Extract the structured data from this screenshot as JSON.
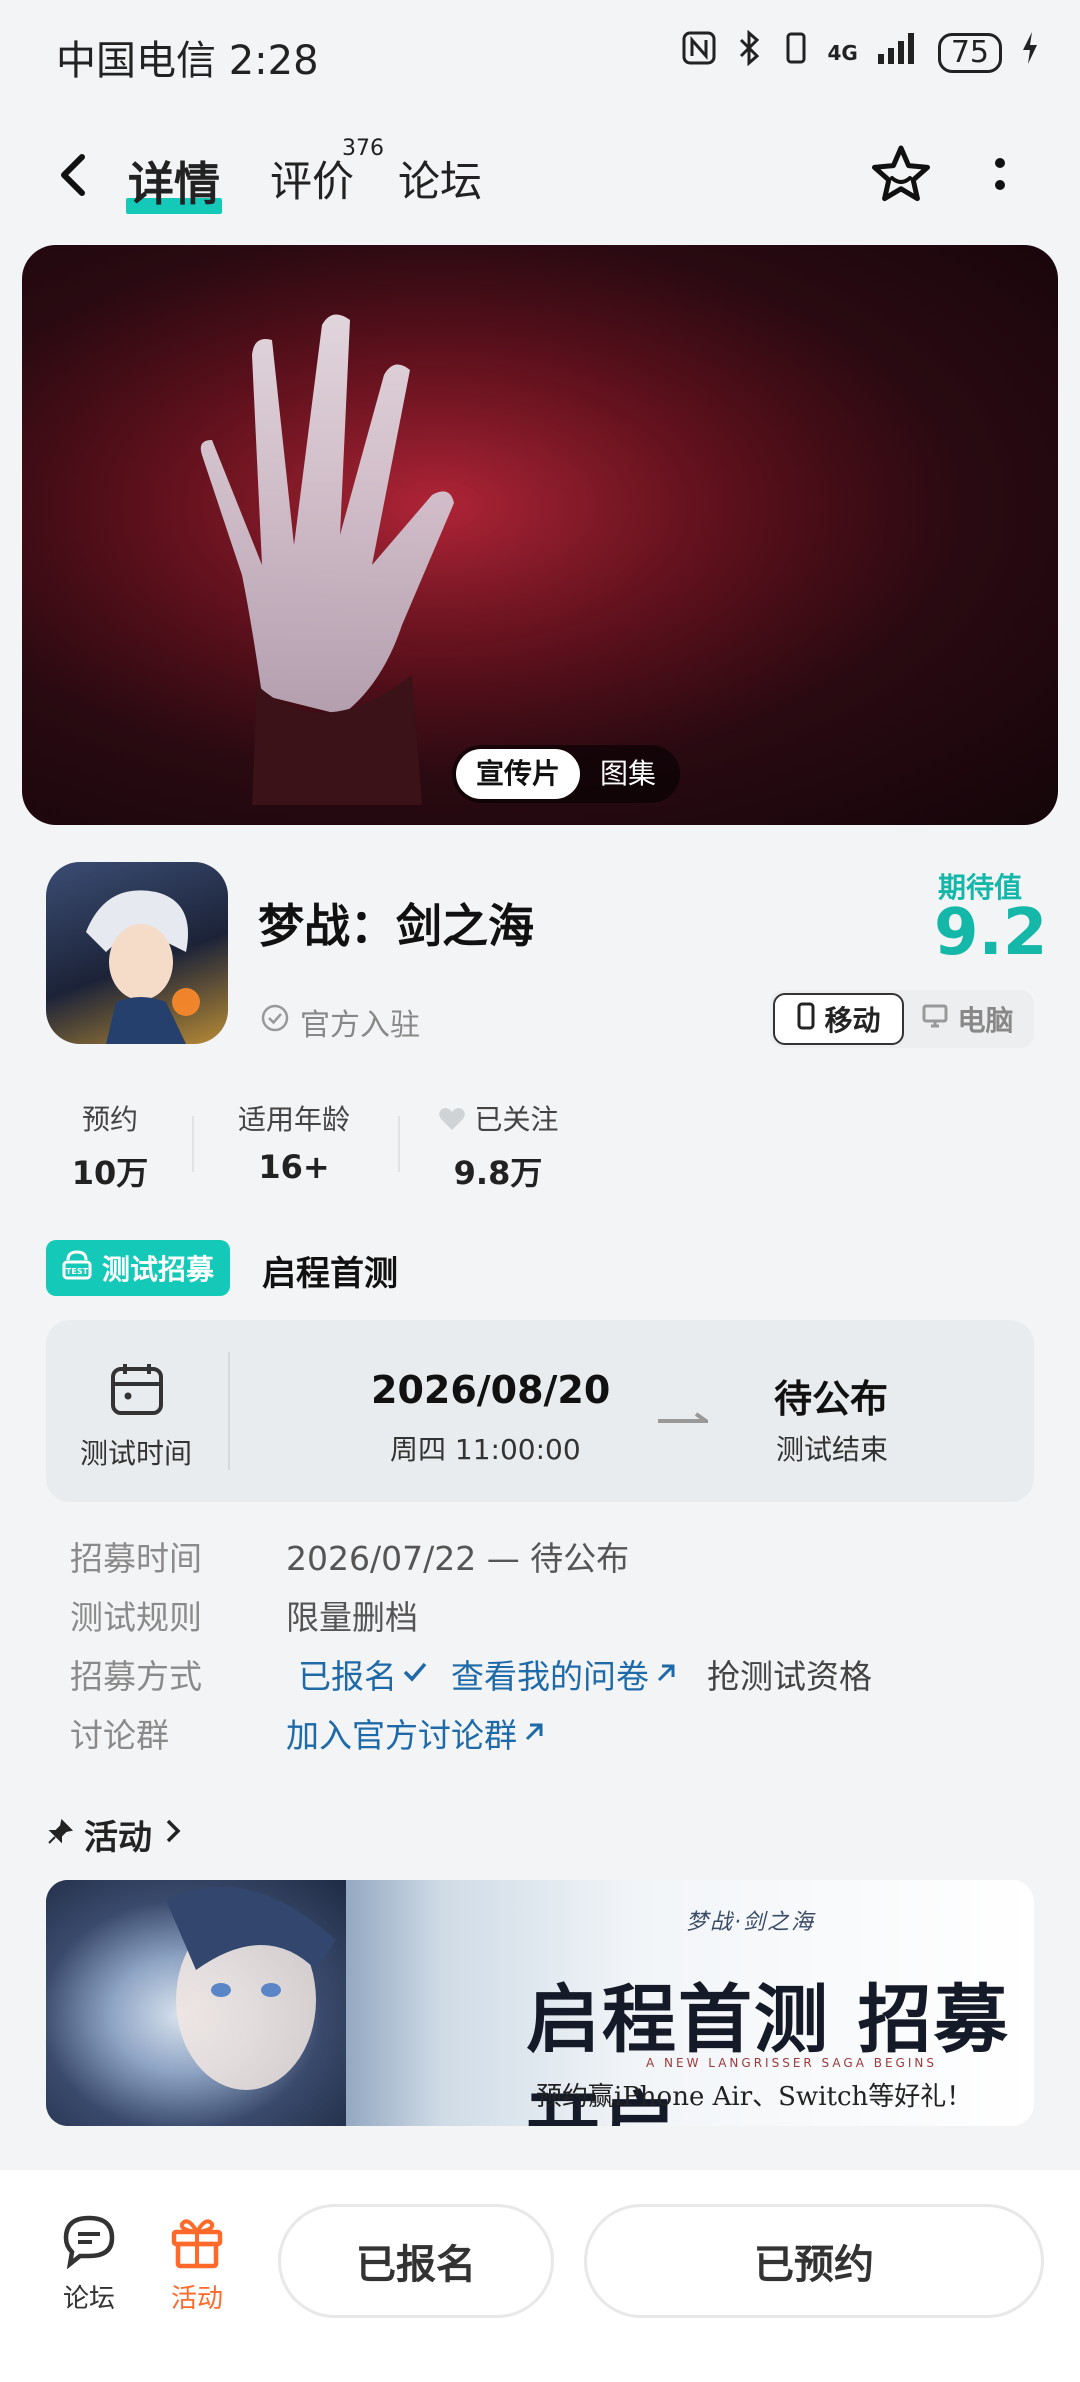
{
  "status_bar": {
    "carrier_time": "中国电信 2:28",
    "network": "4G",
    "battery": "75"
  },
  "nav": {
    "tabs": [
      {
        "label": "详情",
        "active": true
      },
      {
        "label": "评价",
        "badge": "376"
      },
      {
        "label": "论坛"
      }
    ],
    "icons": [
      "back-icon",
      "star-icon",
      "more-icon"
    ]
  },
  "hero": {
    "toggle": [
      "宣传片",
      "图集"
    ],
    "active": "宣传片"
  },
  "game": {
    "title": "梦战：剑之海",
    "official": "官方入驻",
    "expect_label": "期待值",
    "expect_score": "9.2",
    "platforms": [
      {
        "label": "移动",
        "active": true
      },
      {
        "label": "电脑",
        "active": false
      }
    ],
    "stats": [
      {
        "label": "预约",
        "value": "10万"
      },
      {
        "label": "适用年龄",
        "value": "16+"
      },
      {
        "label": "已关注",
        "value": "9.8万"
      }
    ]
  },
  "recruit": {
    "tag": "测试招募",
    "title": "启程首测",
    "card": {
      "time_label": "测试时间",
      "start_date": "2026/08/20",
      "start_time": "周四  11:00:00",
      "end_title": "待公布",
      "end_label": "测试结束"
    },
    "rows": {
      "period_label": "招募时间",
      "period_value": "2026/07/22 — 待公布",
      "rule_label": "测试规则",
      "rule_value": "限量删档",
      "method_label": "招募方式",
      "method_registered": "已报名",
      "method_survey": "查看我的问卷",
      "method_grab": "抢测试资格",
      "group_label": "讨论群",
      "group_link": "加入官方讨论群"
    }
  },
  "activity": {
    "header": "活动",
    "banner": {
      "logo": "梦战·剑之海",
      "headline": "启程首测 招募开启",
      "en": "A NEW LANGRISSER SAGA BEGINS",
      "sub": "预约赢iPhone Air、Switch等好礼！"
    }
  },
  "bottom": {
    "forum": "论坛",
    "activity": "活动",
    "registered_btn": "已报名",
    "reserved_btn": "已预约"
  },
  "colors": {
    "accent": "#14c9b8",
    "orange": "#ff6a2b",
    "link": "#1e6aa8"
  }
}
